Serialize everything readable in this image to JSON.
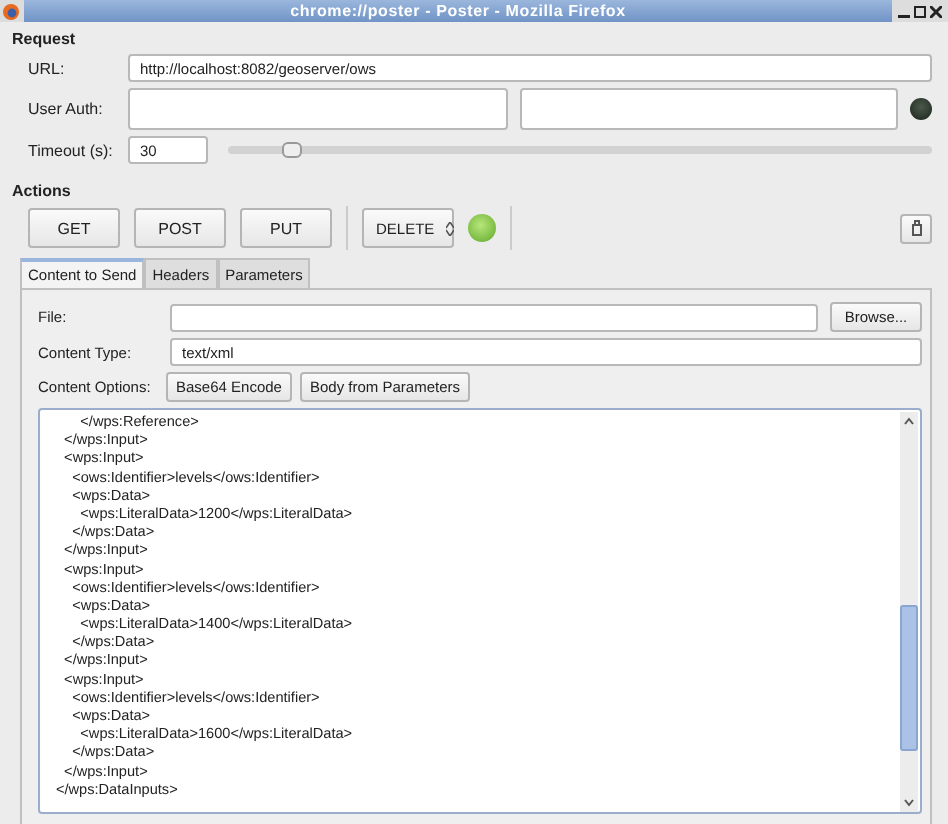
{
  "window": {
    "title": "chrome://poster - Poster - Mozilla Firefox"
  },
  "request": {
    "heading": "Request",
    "url": {
      "label": "URL:",
      "value": "http://localhost:8082/geoserver/ows"
    },
    "user_auth": {
      "label": "User Auth:"
    },
    "timeout": {
      "label": "Timeout (s):",
      "value": "30",
      "level": 0.09
    }
  },
  "actions": {
    "heading": "Actions",
    "buttons": [
      "GET",
      "POST",
      "PUT"
    ],
    "method_select": {
      "value": "DELETE"
    }
  },
  "tabs": [
    {
      "label": "Content to Send",
      "selected": true
    },
    {
      "label": "Headers",
      "selected": false
    },
    {
      "label": "Parameters",
      "selected": false
    }
  ],
  "content": {
    "file": {
      "label": "File:"
    },
    "browse_button": "Browse...",
    "content_type": {
      "label": "Content Type:",
      "value": "text/xml"
    },
    "options": {
      "label": "Content Options:",
      "buttons": [
        "Base64 Encode",
        "Body from Parameters"
      ]
    },
    "body_lines": [
      "      </wps:Reference>",
      "  </wps:Input>",
      "  <wps:Input>",
      "    <ows:Identifier>levels</ows:Identifier>",
      "    <wps:Data>",
      "      <wps:LiteralData>1200</wps:LiteralData>",
      "    </wps:Data>",
      "  </wps:Input>",
      "  <wps:Input>",
      "    <ows:Identifier>levels</ows:Identifier>",
      "    <wps:Data>",
      "      <wps:LiteralData>1400</wps:LiteralData>",
      "    </wps:Data>",
      "  </wps:Input>",
      "  <wps:Input>",
      "    <ows:Identifier>levels</ows:Identifier>",
      "    <wps:Data>",
      "      <wps:LiteralData>1600</wps:LiteralData>",
      "    </wps:Data>",
      "  </wps:Input>",
      "</wps:DataInputs>"
    ]
  }
}
